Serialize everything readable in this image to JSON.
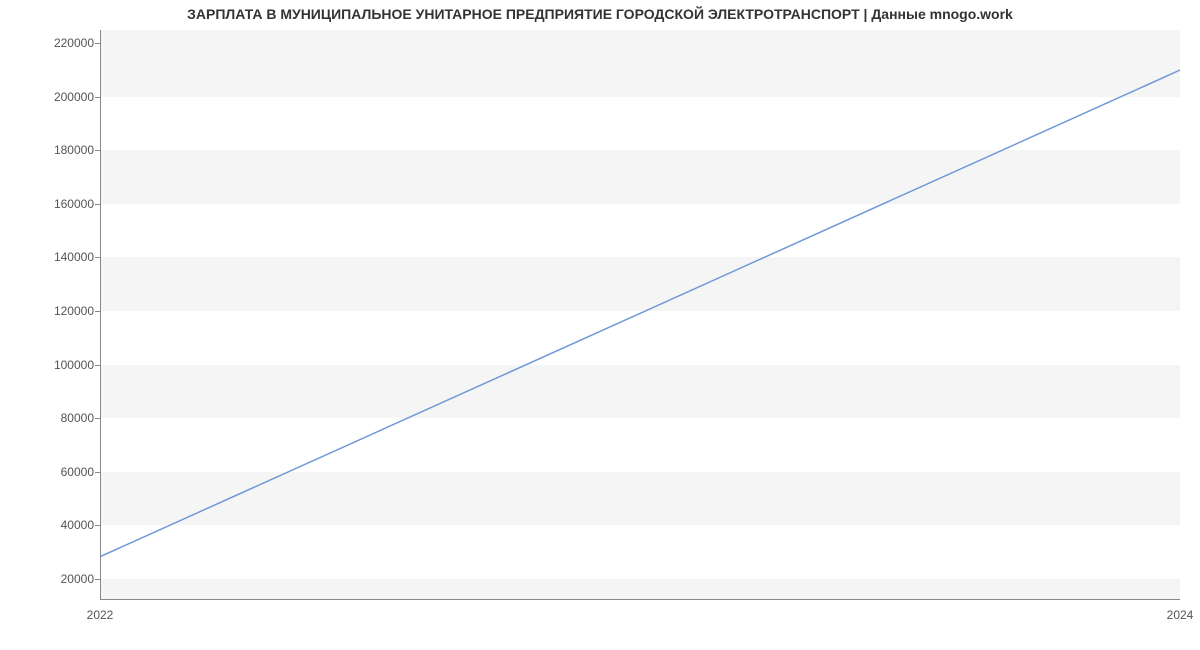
{
  "chart_data": {
    "type": "line",
    "title": "ЗАРПЛАТА В МУНИЦИПАЛЬНОЕ УНИТАРНОЕ ПРЕДПРИЯТИЕ ГОРОДСКОЙ ЭЛЕКТРОТРАНСПОРТ | Данные mnogo.work",
    "xlabel": "",
    "ylabel": "",
    "x": [
      2022,
      2024
    ],
    "values": [
      28000,
      210000
    ],
    "x_ticks": [
      2022,
      2024
    ],
    "y_ticks": [
      20000,
      40000,
      60000,
      80000,
      100000,
      120000,
      140000,
      160000,
      180000,
      200000,
      220000
    ],
    "ylim": [
      12000,
      225000
    ],
    "xlim": [
      2022,
      2024
    ],
    "line_color": "#6f9ad8",
    "grid": "banded"
  },
  "x_tick_labels": [
    "2022",
    "2024"
  ],
  "y_tick_labels": [
    "20000",
    "40000",
    "60000",
    "80000",
    "100000",
    "120000",
    "140000",
    "160000",
    "180000",
    "200000",
    "220000"
  ]
}
